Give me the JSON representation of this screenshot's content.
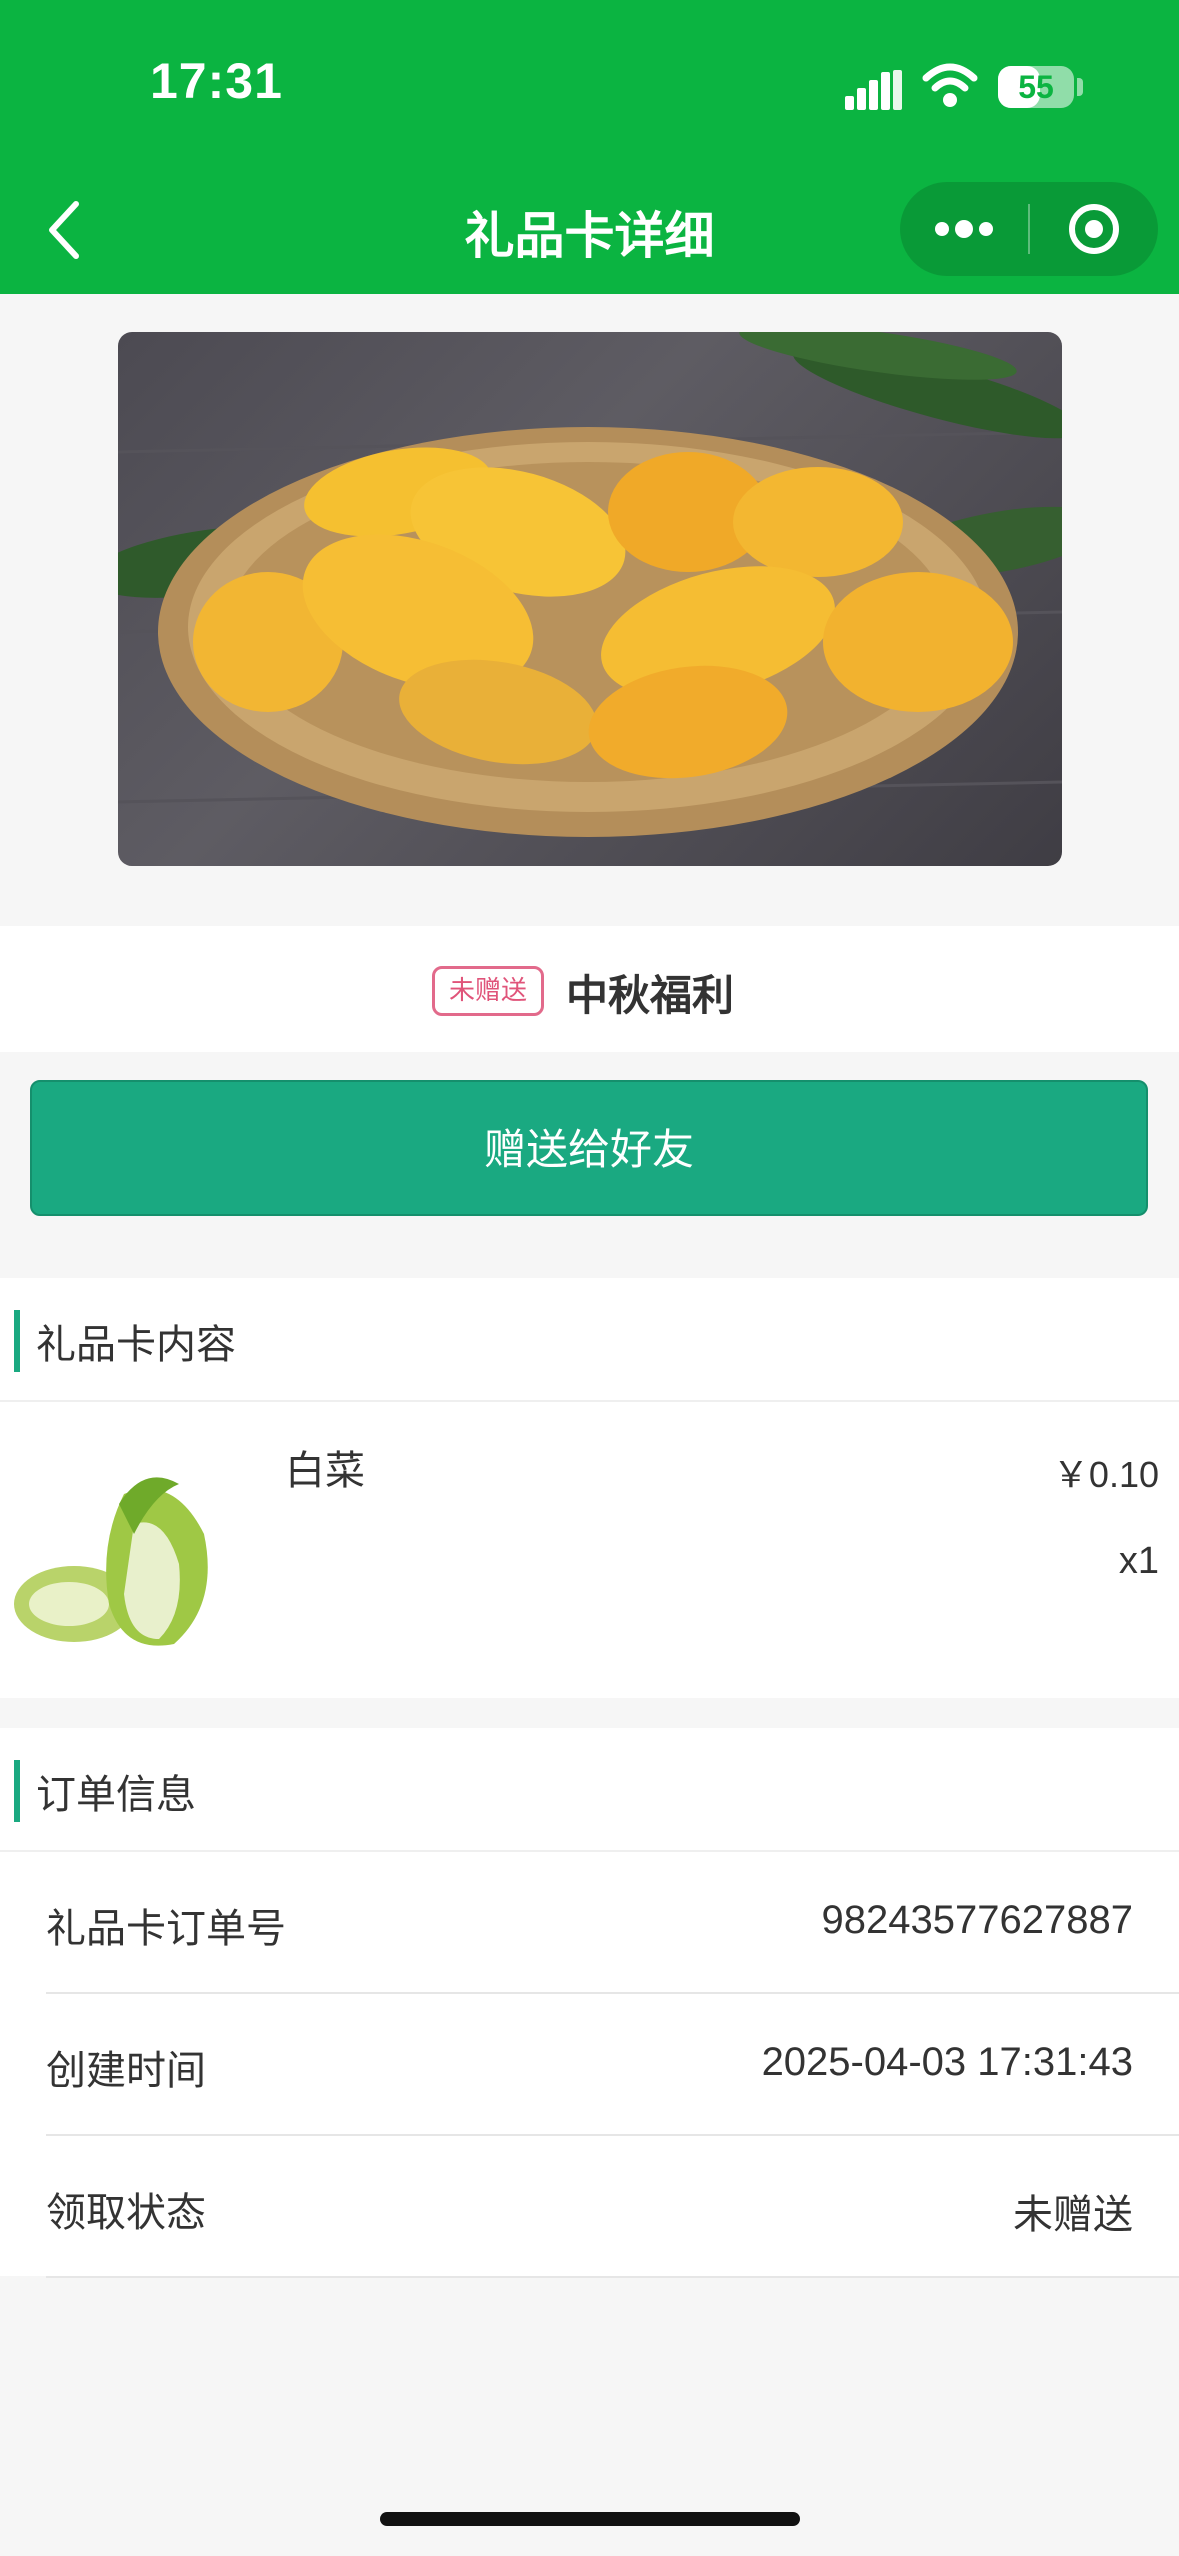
{
  "status_bar": {
    "time": "17:31",
    "battery": "55",
    "battery_level": 0.55
  },
  "nav": {
    "title": "礼品卡详细"
  },
  "card": {
    "status_tag": "未赠送",
    "name": "中秋福利"
  },
  "actions": {
    "send_label": "赠送给好友"
  },
  "contents_section": {
    "title": "礼品卡内容",
    "items": [
      {
        "name": "白菜",
        "price": "￥0.10",
        "quantity": "x1"
      }
    ]
  },
  "order_section": {
    "title": "订单信息",
    "rows": [
      {
        "label": "礼品卡订单号",
        "value": "98243577627887"
      },
      {
        "label": "创建时间",
        "value": "2025-04-03 17:31:43"
      },
      {
        "label": "领取状态",
        "value": "未赠送"
      }
    ]
  },
  "colors": {
    "header": "#0bb441",
    "accent": "#1aa981",
    "tag": "#e0547a"
  }
}
